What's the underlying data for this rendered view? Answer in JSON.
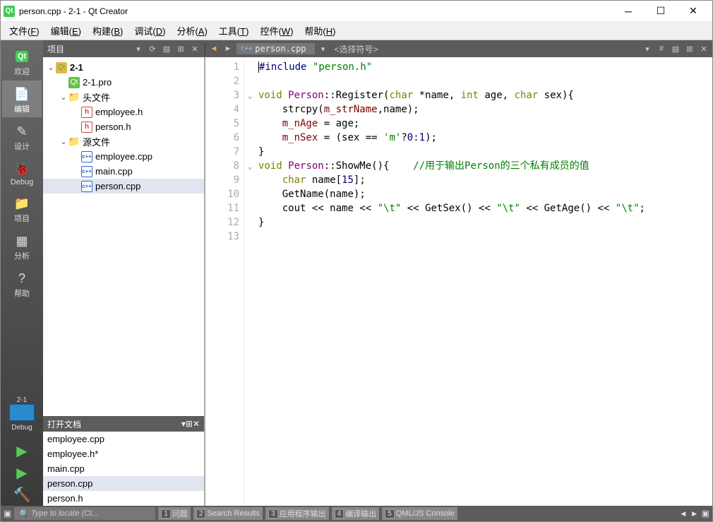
{
  "window": {
    "title": "person.cpp - 2-1 - Qt Creator"
  },
  "menu": {
    "items": [
      {
        "label": "文件",
        "accel": "F"
      },
      {
        "label": "编辑",
        "accel": "E"
      },
      {
        "label": "构建",
        "accel": "B"
      },
      {
        "label": "调试",
        "accel": "D"
      },
      {
        "label": "分析",
        "accel": "A"
      },
      {
        "label": "工具",
        "accel": "T"
      },
      {
        "label": "控件",
        "accel": "W"
      },
      {
        "label": "帮助",
        "accel": "H"
      }
    ]
  },
  "sidebar": {
    "items": [
      {
        "label": "欢迎",
        "icon": "qt"
      },
      {
        "label": "编辑",
        "icon": "doc",
        "selected": true
      },
      {
        "label": "设计",
        "icon": "design"
      },
      {
        "label": "Debug",
        "icon": "bug"
      },
      {
        "label": "项目",
        "icon": "proj"
      },
      {
        "label": "分析",
        "icon": "analyze"
      },
      {
        "label": "帮助",
        "icon": "help"
      }
    ],
    "kit_label": "2-1",
    "debug_label": "Debug"
  },
  "toolbar": {
    "project_combo": "项目",
    "file_tab": "person.cpp",
    "symbol_combo": "<选择符号>"
  },
  "tree": {
    "project": "2-1",
    "pro_file": "2-1.pro",
    "headers_label": "头文件",
    "headers": [
      "employee.h",
      "person.h"
    ],
    "sources_label": "源文件",
    "sources": [
      "employee.cpp",
      "main.cpp",
      "person.cpp"
    ],
    "selected": "person.cpp"
  },
  "open_docs": {
    "title": "打开文档",
    "items": [
      "employee.cpp",
      "employee.h*",
      "main.cpp",
      "person.cpp",
      "person.h"
    ],
    "selected": "person.cpp"
  },
  "code": {
    "lines": [
      {
        "n": 1,
        "tokens": [
          [
            "pre",
            "#include "
          ],
          [
            "str",
            "\"person.h\""
          ]
        ]
      },
      {
        "n": 2,
        "tokens": []
      },
      {
        "n": 3,
        "fold": true,
        "tokens": [
          [
            "kw",
            "void "
          ],
          [
            "typename",
            "Person"
          ],
          [
            "op",
            "::"
          ],
          [
            "func",
            "Register"
          ],
          [
            "op",
            "("
          ],
          [
            "kw",
            "char"
          ],
          [
            "op",
            " *"
          ],
          [
            "func",
            "name"
          ],
          [
            "op",
            ", "
          ],
          [
            "kw",
            "int"
          ],
          [
            "op",
            " "
          ],
          [
            "func",
            "age"
          ],
          [
            "op",
            ", "
          ],
          [
            "kw",
            "char"
          ],
          [
            "op",
            " "
          ],
          [
            "func",
            "sex"
          ],
          [
            "op",
            "){"
          ]
        ]
      },
      {
        "n": 4,
        "tokens": [
          [
            "op",
            "    "
          ],
          [
            "func",
            "strcpy"
          ],
          [
            "op",
            "("
          ],
          [
            "member",
            "m_strName"
          ],
          [
            "op",
            ","
          ],
          [
            "func",
            "name"
          ],
          [
            "op",
            ");"
          ]
        ]
      },
      {
        "n": 5,
        "tokens": [
          [
            "op",
            "    "
          ],
          [
            "member",
            "m_nAge"
          ],
          [
            "op",
            " = "
          ],
          [
            "func",
            "age"
          ],
          [
            "op",
            ";"
          ]
        ]
      },
      {
        "n": 6,
        "tokens": [
          [
            "op",
            "    "
          ],
          [
            "member",
            "m_nSex"
          ],
          [
            "op",
            " = ("
          ],
          [
            "func",
            "sex"
          ],
          [
            "op",
            " == "
          ],
          [
            "str",
            "'m'"
          ],
          [
            "op",
            "?"
          ],
          [
            "num",
            "0"
          ],
          [
            "op",
            ":"
          ],
          [
            "num",
            "1"
          ],
          [
            "op",
            ");"
          ]
        ]
      },
      {
        "n": 7,
        "tokens": [
          [
            "op",
            "}"
          ]
        ]
      },
      {
        "n": 8,
        "fold": true,
        "tokens": [
          [
            "kw",
            "void "
          ],
          [
            "typename",
            "Person"
          ],
          [
            "op",
            "::"
          ],
          [
            "func",
            "ShowMe"
          ],
          [
            "op",
            "(){    "
          ],
          [
            "cm",
            "//用于输出Person的三个私有成员的值"
          ]
        ]
      },
      {
        "n": 9,
        "tokens": [
          [
            "op",
            "    "
          ],
          [
            "kw",
            "char"
          ],
          [
            "op",
            " "
          ],
          [
            "func",
            "name"
          ],
          [
            "op",
            "["
          ],
          [
            "num",
            "15"
          ],
          [
            "op",
            "];"
          ]
        ]
      },
      {
        "n": 10,
        "tokens": [
          [
            "op",
            "    "
          ],
          [
            "func",
            "GetName"
          ],
          [
            "op",
            "("
          ],
          [
            "func",
            "name"
          ],
          [
            "op",
            ");"
          ]
        ]
      },
      {
        "n": 11,
        "tokens": [
          [
            "op",
            "    "
          ],
          [
            "func",
            "cout"
          ],
          [
            "op",
            " << "
          ],
          [
            "func",
            "name"
          ],
          [
            "op",
            " << "
          ],
          [
            "str",
            "\"\\t\""
          ],
          [
            "op",
            " << "
          ],
          [
            "func",
            "GetSex"
          ],
          [
            "op",
            "() << "
          ],
          [
            "str",
            "\"\\t\""
          ],
          [
            "op",
            " << "
          ],
          [
            "func",
            "GetAge"
          ],
          [
            "op",
            "() << "
          ],
          [
            "str",
            "\"\\t\""
          ],
          [
            "op",
            ";"
          ]
        ]
      },
      {
        "n": 12,
        "tokens": [
          [
            "op",
            "}"
          ]
        ]
      },
      {
        "n": 13,
        "tokens": []
      }
    ]
  },
  "statusbar": {
    "locator_placeholder": "Type to locate (Ct...",
    "outputs": [
      {
        "n": "1",
        "label": "问题"
      },
      {
        "n": "2",
        "label": "Search Results"
      },
      {
        "n": "3",
        "label": "应用程序输出"
      },
      {
        "n": "4",
        "label": "编译输出"
      },
      {
        "n": "5",
        "label": "QML/JS Console"
      }
    ]
  }
}
